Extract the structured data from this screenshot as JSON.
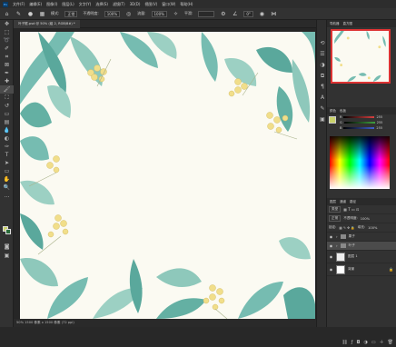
{
  "menu": {
    "logo": "Ps",
    "items": [
      "文件(F)",
      "编辑(E)",
      "图像(I)",
      "图层(L)",
      "文字(Y)",
      "选择(S)",
      "滤镜(T)",
      "3D(D)",
      "视图(V)",
      "窗口(W)",
      "帮助(H)"
    ]
  },
  "options": {
    "mode_label": "模式:",
    "mode_value": "正常",
    "opacity_label": "不透明度:",
    "opacity_value": "100%",
    "flow_label": "流量:",
    "flow_value": "100%",
    "smooth_label": "平滑:",
    "angle_value": "0°"
  },
  "document_tab": "叶子框.psd @ 50% (组 2, RGB/8#) *",
  "status_bar": "50%    1500 像素 x 1500 像素 (72 ppi)",
  "panels": {
    "navigator_tabs": [
      "导航器",
      "直方图"
    ],
    "color_tabs": [
      "颜色",
      "色板"
    ],
    "color_sliders": [
      {
        "label": "R",
        "value": "255",
        "color": "#d84040"
      },
      {
        "label": "G",
        "value": "255",
        "color": "#40a040"
      },
      {
        "label": "B",
        "value": "255",
        "color": "#4060d0"
      }
    ],
    "layers_tabs": [
      "图层",
      "通道",
      "路径"
    ],
    "layer_kind": "类型",
    "blend_mode": "正常",
    "opacity_label": "不透明度:",
    "opacity_value": "100%",
    "lock_label": "锁定:",
    "fill_label": "填充:",
    "fill_value": "100%",
    "layers": [
      {
        "name": "果子",
        "type": "group"
      },
      {
        "name": "叶子",
        "type": "group"
      },
      {
        "name": "图层 1",
        "type": "pixel"
      },
      {
        "name": "背景",
        "type": "pixel"
      }
    ]
  },
  "colors": {
    "foreground": "#c9d26a",
    "background": "#2b6b3a",
    "leaf_dark": "#3f9a8e",
    "leaf_light": "#8cc9bb",
    "berry": "#f1de8a"
  },
  "icons": {
    "tools": [
      "move-icon",
      "marquee-icon",
      "lasso-icon",
      "quick-select-icon",
      "crop-icon",
      "eyedropper-icon",
      "healing-icon",
      "brush-icon",
      "stamp-icon",
      "history-brush-icon",
      "eraser-icon",
      "gradient-icon",
      "blur-icon",
      "dodge-icon",
      "pen-icon",
      "type-icon",
      "path-select-icon",
      "shape-icon",
      "hand-icon",
      "zoom-icon"
    ],
    "strip": [
      "history-icon",
      "properties-icon",
      "adjustments-icon",
      "libraries-icon",
      "paragraph-icon",
      "character-icon",
      "brush-settings-icon",
      "layer-comps-icon"
    ]
  }
}
